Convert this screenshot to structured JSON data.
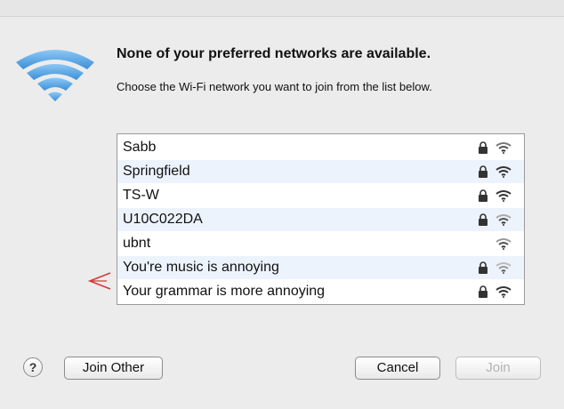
{
  "dialog": {
    "title": "None of your preferred networks are available.",
    "subtitle": "Choose the Wi-Fi network you want to join from the list below."
  },
  "networks": [
    {
      "name": "Sabb",
      "secured": true
    },
    {
      "name": "Springfield",
      "secured": true
    },
    {
      "name": "TS-W",
      "secured": true
    },
    {
      "name": "U10C022DA",
      "secured": true
    },
    {
      "name": "ubnt",
      "secured": false
    },
    {
      "name": "You're music is annoying",
      "secured": true
    },
    {
      "name": "Your grammar is more annoying",
      "secured": true
    }
  ],
  "buttons": {
    "help": "?",
    "join_other": "Join Other",
    "cancel": "Cancel",
    "join": "Join"
  },
  "colors": {
    "wifi_blue": "#4a9be0",
    "annotation_red": "#d23b3b",
    "row_alt": "#edf3fc"
  },
  "icons": {
    "dialog_icon": "wifi-icon",
    "secure_icon": "lock-icon",
    "signal_icon": "wifi-signal-icon",
    "annotation": "red-arrow-icon"
  }
}
